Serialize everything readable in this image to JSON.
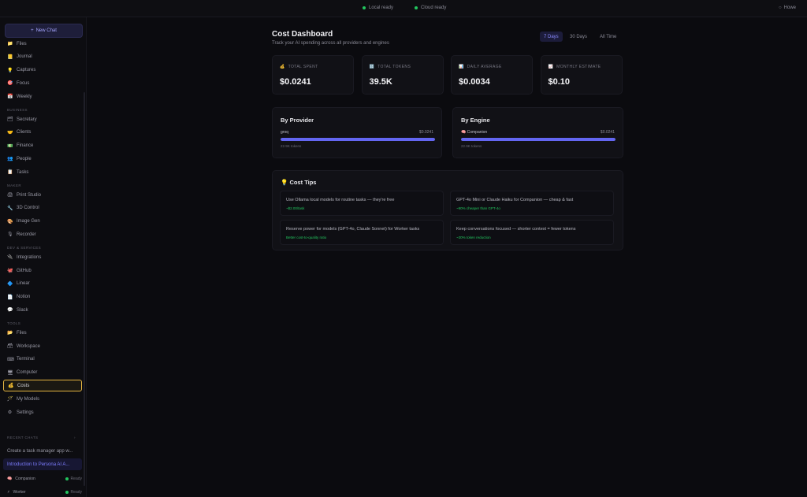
{
  "topbar": {
    "status_local": "Local ready",
    "status_cloud": "Cloud ready",
    "user": "Howe"
  },
  "sidebar": {
    "new_chat": "New Chat",
    "items_top": [
      {
        "icon": "📁",
        "label": "Files"
      },
      {
        "icon": "📒",
        "label": "Journal"
      },
      {
        "icon": "💡",
        "label": "Captures"
      },
      {
        "icon": "🎯",
        "label": "Focus"
      },
      {
        "icon": "📅",
        "label": "Weekly"
      }
    ],
    "section_business": "BUSINESS",
    "items_business": [
      {
        "icon": "🗂",
        "label": "Secretary"
      },
      {
        "icon": "🤝",
        "label": "Clients"
      },
      {
        "icon": "💵",
        "label": "Finance"
      },
      {
        "icon": "👥",
        "label": "People"
      },
      {
        "icon": "📋",
        "label": "Tasks"
      }
    ],
    "section_maker": "MAKER",
    "items_maker": [
      {
        "icon": "🖨",
        "label": "Print Studio"
      },
      {
        "icon": "🔧",
        "label": "3D Control"
      },
      {
        "icon": "🎨",
        "label": "Image Gen"
      },
      {
        "icon": "🎙",
        "label": "Recorder"
      }
    ],
    "section_dev": "DEV & SERVICES",
    "items_dev": [
      {
        "icon": "🔌",
        "label": "Integrations"
      },
      {
        "icon": "🐙",
        "label": "GitHub"
      },
      {
        "icon": "🔷",
        "label": "Linear"
      },
      {
        "icon": "📄",
        "label": "Notion"
      },
      {
        "icon": "💬",
        "label": "Slack"
      }
    ],
    "section_tools": "TOOLS",
    "items_tools": [
      {
        "icon": "📂",
        "label": "Files"
      },
      {
        "icon": "🗃",
        "label": "Workspace"
      },
      {
        "icon": "⌨",
        "label": "Terminal"
      },
      {
        "icon": "🖥",
        "label": "Computer"
      },
      {
        "icon": "💰",
        "label": "Costs",
        "active": true
      },
      {
        "icon": "🪄",
        "label": "My Models"
      },
      {
        "icon": "⚙",
        "label": "Settings"
      }
    ],
    "section_recent": "RECENT CHATS",
    "recent": [
      {
        "label": "Create a task manager app w..."
      },
      {
        "label": "Introduction to Persona AI A...",
        "highlight": true
      }
    ],
    "agents": [
      {
        "icon": "🧠",
        "name": "Companion",
        "status": "Ready"
      },
      {
        "icon": "⚡",
        "name": "Worker",
        "status": "Ready"
      }
    ]
  },
  "header": {
    "title": "Cost Dashboard",
    "subtitle": "Track your AI spending across all providers and engines",
    "ranges": [
      "7 Days",
      "30 Days",
      "All Time"
    ],
    "selected_range": "7 Days"
  },
  "stats": [
    {
      "icon": "💰",
      "label": "TOTAL SPENT",
      "value": "$0.0241"
    },
    {
      "icon": "🔢",
      "label": "TOTAL TOKENS",
      "value": "39.5K"
    },
    {
      "icon": "📊",
      "label": "DAILY AVERAGE",
      "value": "$0.0034"
    },
    {
      "icon": "📈",
      "label": "MONTHLY ESTIMATE",
      "value": "$0.10"
    }
  ],
  "by_provider": {
    "title": "By Provider",
    "rows": [
      {
        "name": "groq",
        "cost": "$0.0241",
        "tokens": "22.9K tokens",
        "share": 1.0
      }
    ]
  },
  "by_engine": {
    "title": "By Engine",
    "rows": [
      {
        "icon": "🧠",
        "name": "Companion",
        "cost": "$0.0241",
        "tokens": "22.9K tokens",
        "share": 1.0
      }
    ]
  },
  "tips": {
    "title": "Cost Tips",
    "icon": "💡",
    "items": [
      {
        "text": "Use Ollama local models for routine tasks — they're free",
        "saving": "~$2.00/task"
      },
      {
        "text": "GPT-4o Mini or Claude Haiku for Companion — cheap & fast",
        "saving": "~90% cheaper than GPT-4o"
      },
      {
        "text": "Reserve power for models (GPT-4o, Claude Sonnet) for Worker tasks",
        "saving": "Better cost-to-quality ratio"
      },
      {
        "text": "Keep conversations focused — shorter context = fewer tokens",
        "saving": "~30% token reduction"
      }
    ]
  },
  "colors": {
    "accent": "#6366f1",
    "success": "#22c55e",
    "highlight": "#e3b341"
  }
}
